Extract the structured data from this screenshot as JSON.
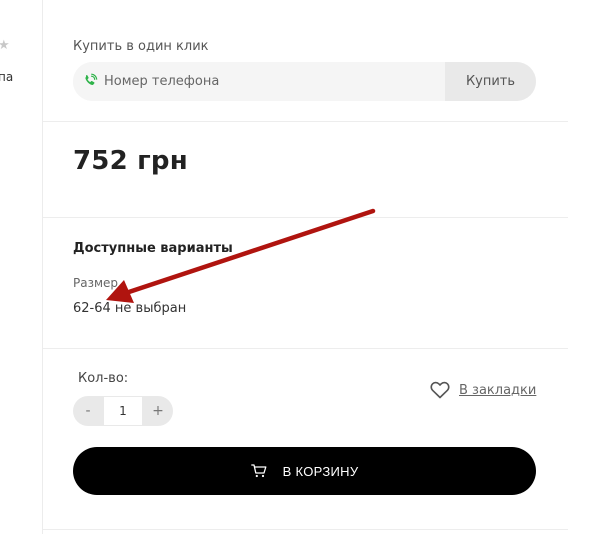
{
  "left_fragment": {
    "star_glyph": "★",
    "text": "па"
  },
  "one_click": {
    "label": "Купить в один клик",
    "phone_placeholder": "Номер телефона",
    "phone_value": "",
    "buy_label": "Купить"
  },
  "price": {
    "text": "752 грн"
  },
  "variants": {
    "title": "Доступные варианты",
    "size_label": "Размер",
    "size_value": "62-64 не выбран"
  },
  "quantity": {
    "label": "Кол-во:",
    "minus": "-",
    "plus": "+",
    "value": "1"
  },
  "bookmark": {
    "label": "В закладки"
  },
  "cart": {
    "label": "В КОРЗИНУ"
  },
  "colors": {
    "cart_button": "#000000",
    "annotation_arrow": "#b0140f",
    "phone_icon": "#2fb34a"
  },
  "icons": {
    "phone": "phone-icon",
    "bookmark": "heart-icon",
    "cart": "cart-icon"
  }
}
